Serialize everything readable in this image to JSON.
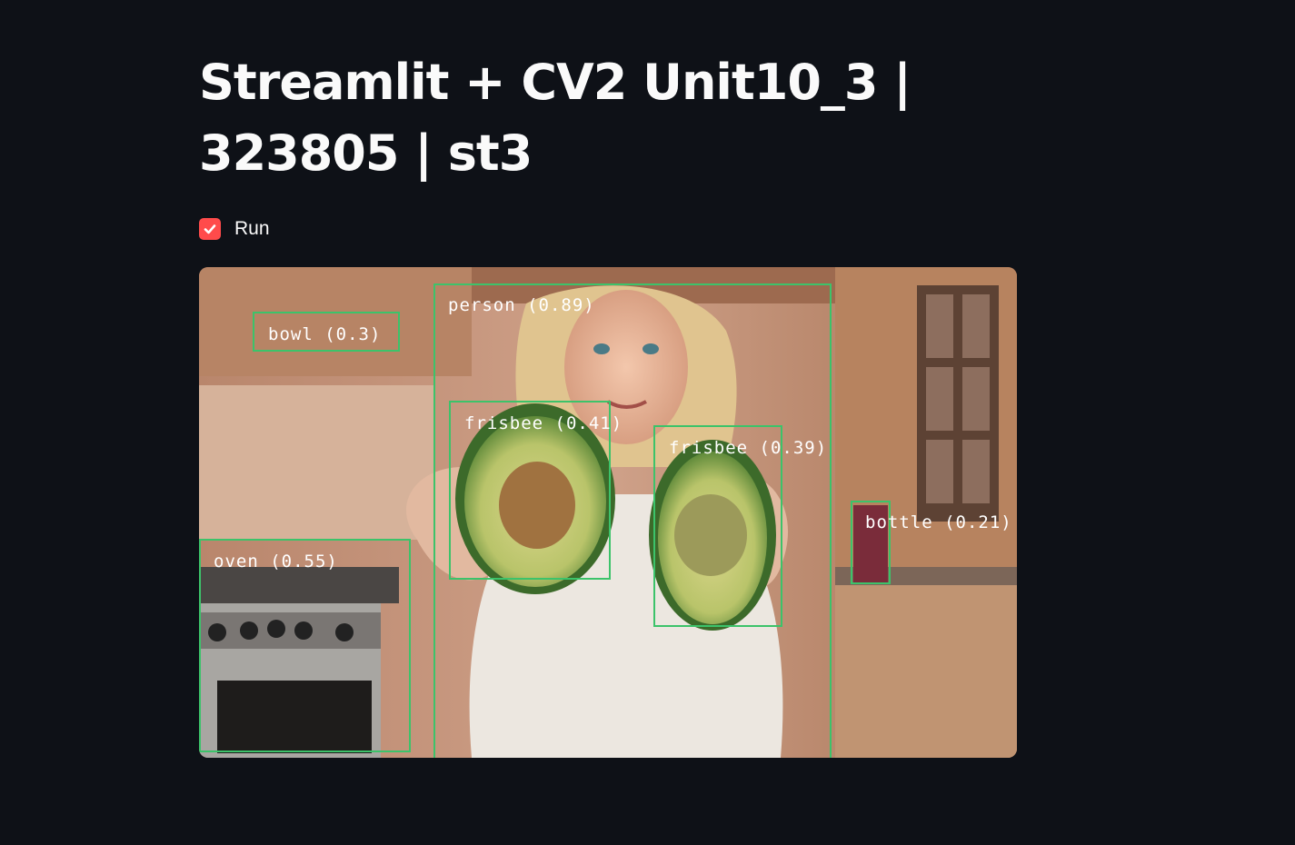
{
  "page": {
    "title": "Streamlit + CV2 Unit10_3 | 323805 | st3"
  },
  "controls": {
    "run_checkbox": {
      "label": "Run",
      "checked": true,
      "accent_color": "#ff4b4b"
    }
  },
  "video": {
    "box_color": "#3cc36a",
    "detections": [
      {
        "label": "person (0.89)"
      },
      {
        "label": "bowl (0.3)"
      },
      {
        "label": "frisbee (0.41)"
      },
      {
        "label": "frisbee (0.39)"
      },
      {
        "label": "bottle (0.21)"
      },
      {
        "label": "oven (0.55)"
      }
    ]
  }
}
